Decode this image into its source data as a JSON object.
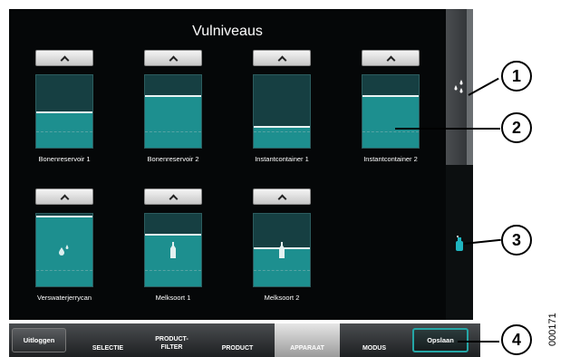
{
  "screen": {
    "title": "Vulniveaus"
  },
  "containers": [
    {
      "label": "Bonenreservoir 1",
      "level_percent": 50,
      "icon": "none"
    },
    {
      "label": "Bonenreservoir 2",
      "level_percent": 72,
      "icon": "none"
    },
    {
      "label": "Instantcontainer 1",
      "level_percent": 30,
      "icon": "none"
    },
    {
      "label": "Instantcontainer 2",
      "level_percent": 72,
      "icon": "none"
    },
    {
      "label": "Verswaterjerrycan",
      "level_percent": 97,
      "icon": "drops-icon"
    },
    {
      "label": "Melksoort 1",
      "level_percent": 72,
      "icon": "milk-bottle-icon"
    },
    {
      "label": "Melksoort 2",
      "level_percent": 54,
      "icon": "milk-bottle-icon"
    }
  ],
  "side_rail": {
    "icons": [
      "water-drops-icon",
      "milk-container-icon"
    ]
  },
  "bottom_bar": {
    "logout_label": "Uitloggen",
    "tabs": [
      {
        "label": "SELECTIE"
      },
      {
        "label": "PRODUCT-\nFILTER"
      },
      {
        "label": "PRODUCT"
      },
      {
        "label": "APPARAAT",
        "active": true
      },
      {
        "label": "MODUS"
      }
    ],
    "save_label": "Opslaan"
  },
  "callouts": [
    "1",
    "2",
    "3",
    "4"
  ],
  "document_id": "000171",
  "colors": {
    "fill": "#1d8f8f",
    "tank_empty": "#163f42",
    "accent": "#24a6a6"
  }
}
